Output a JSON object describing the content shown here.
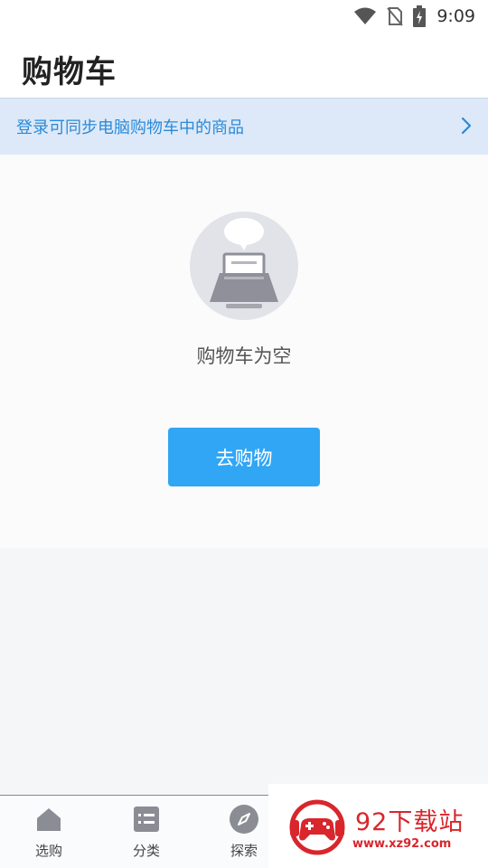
{
  "status_bar": {
    "time": "9:09",
    "icons": [
      "wifi-icon",
      "no-sim-icon",
      "battery-charging-icon"
    ]
  },
  "header": {
    "title": "购物车"
  },
  "login_banner": {
    "text": "登录可同步电脑购物车中的商品",
    "arrow_icon": "chevron-right-icon"
  },
  "empty_state": {
    "illustration_icon": "empty-cart-laptop-icon",
    "message": "购物车为空",
    "button_label": "去购物"
  },
  "bottom_nav": {
    "items": [
      {
        "label": "选购",
        "icon": "home-icon"
      },
      {
        "label": "分类",
        "icon": "list-icon"
      },
      {
        "label": "探索",
        "icon": "compass-icon"
      }
    ]
  },
  "watermark": {
    "text": "92下载站",
    "url": "www.xz92.com",
    "icon": "gamepad-logo-icon"
  },
  "colors": {
    "accent": "#30a6f5",
    "banner_bg": "#dde9f8",
    "banner_text": "#2a8ad9",
    "watermark_red": "#d8262c"
  }
}
